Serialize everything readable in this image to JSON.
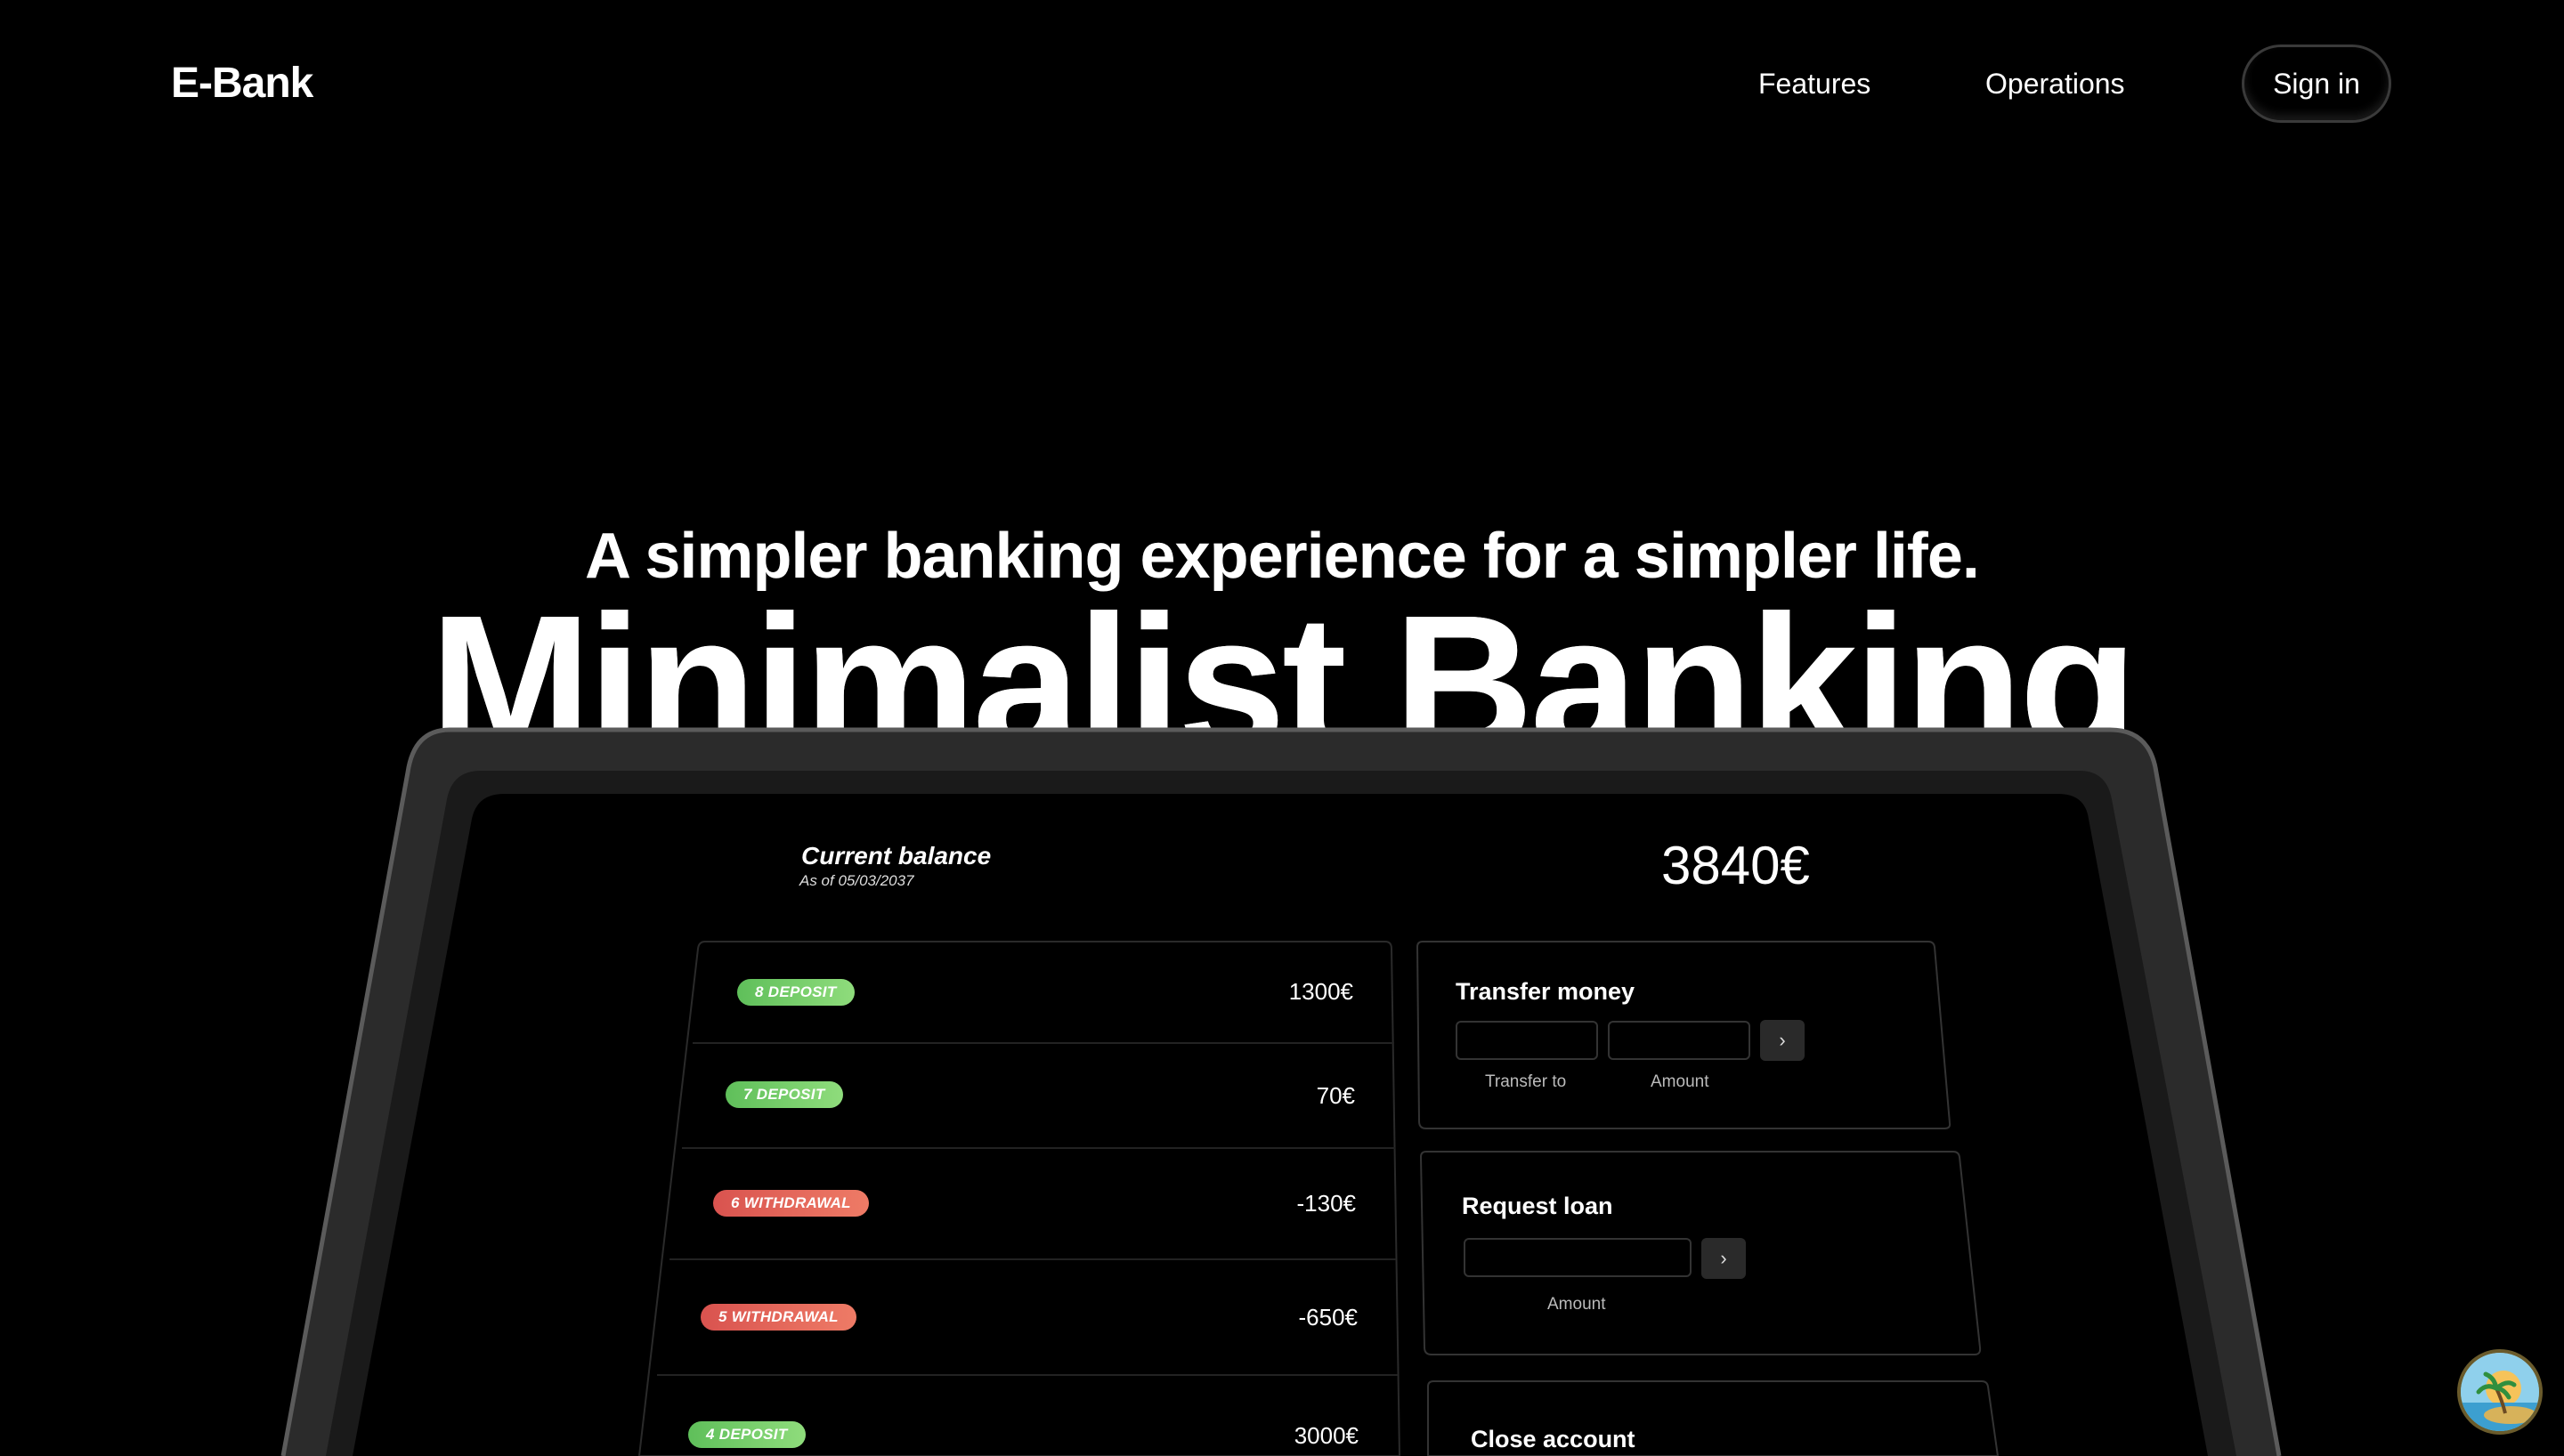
{
  "nav": {
    "logo": "E-Bank",
    "links": [
      "Features",
      "Operations"
    ],
    "signin": "Sign in"
  },
  "hero": {
    "tagline": "A simpler banking experience for a simpler life.",
    "headline": "Minimalist Banking"
  },
  "app": {
    "balance": {
      "label": "Current balance",
      "date": "As of 05/03/2037",
      "value": "3840€"
    },
    "movements": [
      {
        "label": "8 deposit",
        "type": "deposit",
        "value": "1300€"
      },
      {
        "label": "7 deposit",
        "type": "deposit",
        "value": "70€"
      },
      {
        "label": "6 withdrawal",
        "type": "withdrawal",
        "value": "-130€"
      },
      {
        "label": "5 withdrawal",
        "type": "withdrawal",
        "value": "-650€"
      },
      {
        "label": "4 deposit",
        "type": "deposit",
        "value": "3000€"
      }
    ],
    "transfer": {
      "title": "Transfer money",
      "to_label": "Transfer to",
      "amount_label": "Amount",
      "button": "›"
    },
    "loan": {
      "title": "Request loan",
      "amount_label": "Amount",
      "button": "›"
    },
    "close": {
      "title": "Close account"
    }
  },
  "colors": {
    "deposit": "#6cc765",
    "withdrawal": "#e06158",
    "background": "#000000"
  }
}
